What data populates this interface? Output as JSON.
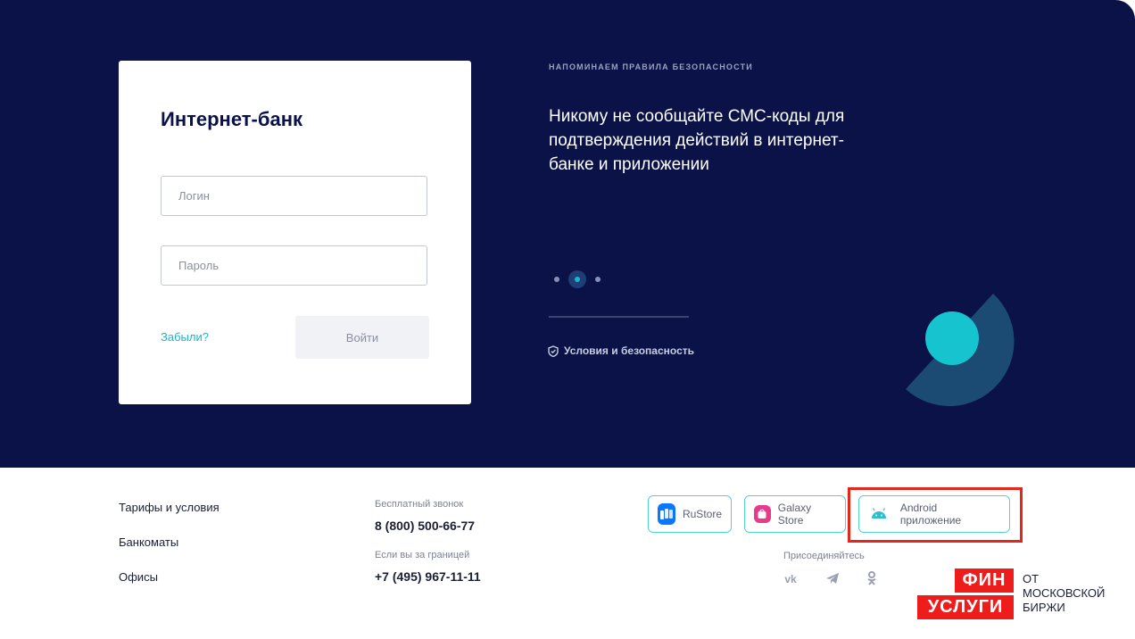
{
  "login_card": {
    "title": "Интернет-банк",
    "login_placeholder": "Логин",
    "password_placeholder": "Пароль",
    "forgot_label": "Забыли?",
    "submit_label": "Войти"
  },
  "reminder": {
    "caption": "НАПОМИНАЕМ ПРАВИЛА БЕЗОПАСНОСТИ",
    "text": "Никому не сообщайте СМС-коды для подтверждения действий в интернет-банке и приложении",
    "slides_total": 3,
    "active_slide": 2,
    "security_link": "Условия и безопасность"
  },
  "footer": {
    "links": [
      "Тарифы и условия",
      "Банкоматы",
      "Офисы"
    ],
    "free_call_caption": "Бесплатный звонок",
    "free_call_number": "8 (800) 500-66-77",
    "abroad_caption": "Если вы за границей",
    "abroad_number": "+7 (495) 967-11-11",
    "stores": [
      {
        "label": "RuStore",
        "icon": "rustore-icon",
        "color": "#0a77ff"
      },
      {
        "label": "Galaxy Store",
        "icon": "galaxy-store-icon",
        "color": "#e8398a"
      },
      {
        "label": "Android приложение",
        "icon": "android-icon",
        "color": "#2bbfcf"
      }
    ],
    "join_caption": "Присоединяйтесь",
    "socials": [
      "vk-icon",
      "telegram-icon",
      "odnoklassniki-icon"
    ]
  },
  "finuslugi": {
    "word1": "ФИН",
    "word2": "УСЛУГИ",
    "side_line1": "ОТ",
    "side_line2": "МОСКОВСКОЙ",
    "side_line3": "БИРЖИ"
  },
  "colors": {
    "hero_bg": "#0a1248",
    "accent": "#16b8c9",
    "highlight": "#e4261b",
    "brand_red": "#ef1c1c"
  }
}
